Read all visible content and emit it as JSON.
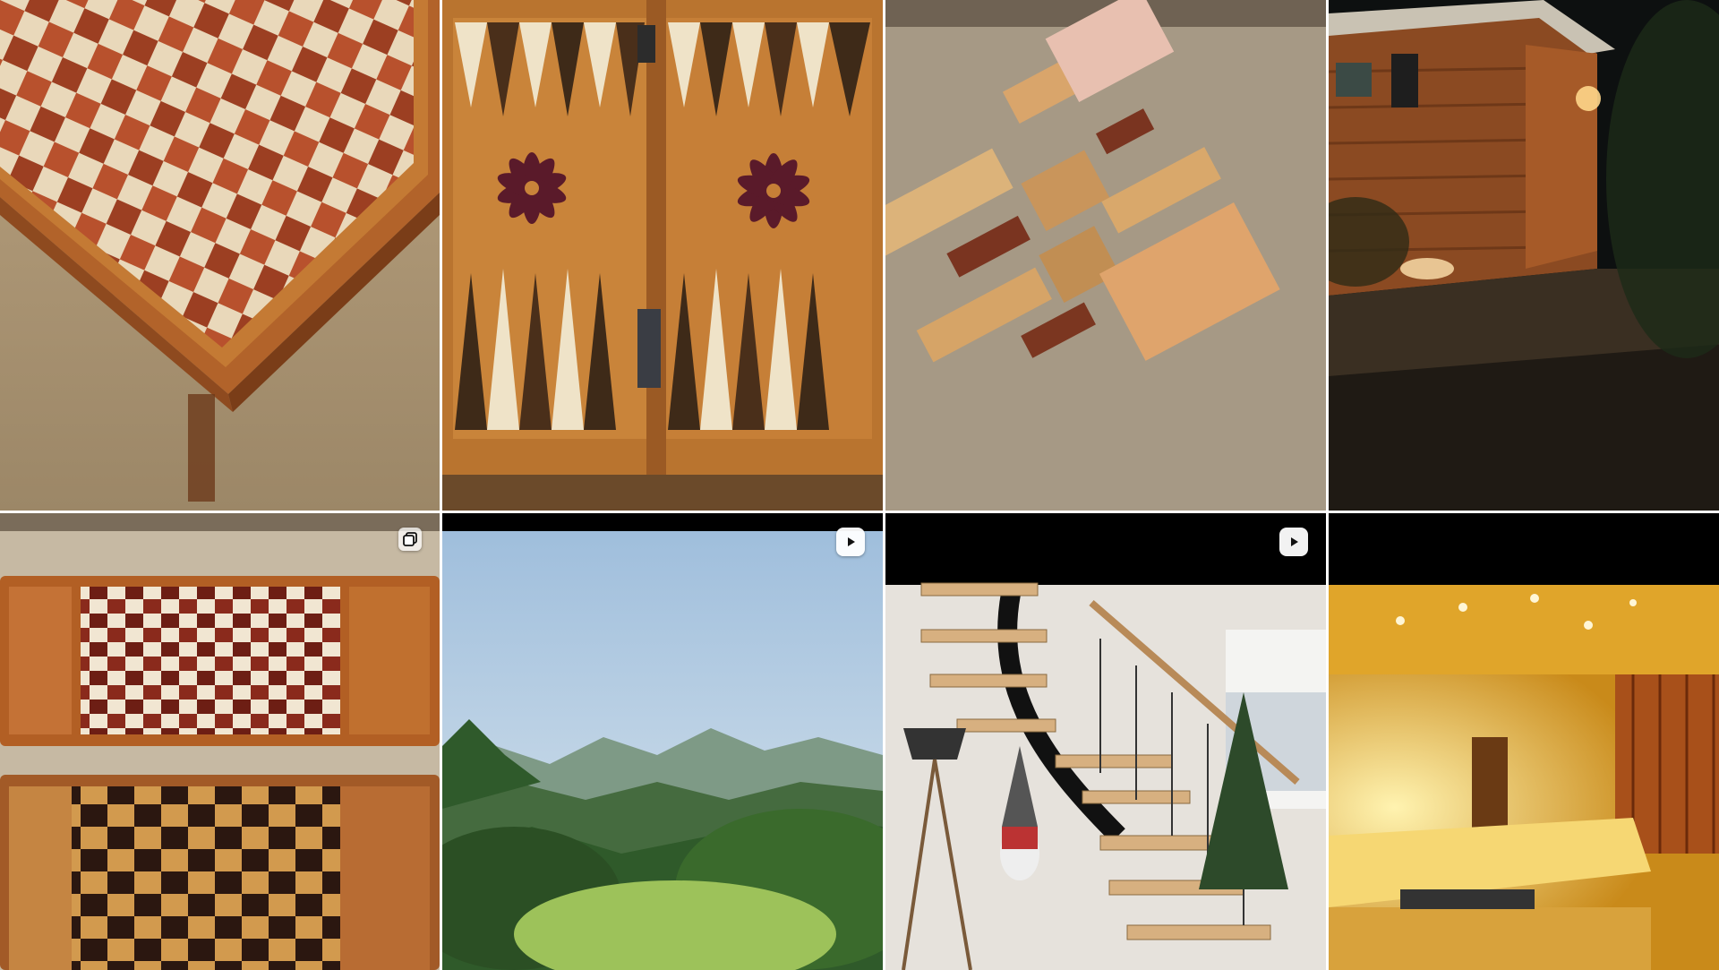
{
  "grid": {
    "posts": [
      {
        "id": "post-1",
        "media_type": "image",
        "subject": "chessboard-table"
      },
      {
        "id": "post-2",
        "media_type": "image",
        "subject": "backgammon-board"
      },
      {
        "id": "post-3",
        "media_type": "image",
        "subject": "woodworking-parts"
      },
      {
        "id": "post-4",
        "media_type": "image",
        "subject": "wooden-cabin-night"
      },
      {
        "id": "post-5",
        "media_type": "carousel",
        "subject": "chess-trays",
        "badge_icon": "carousel-icon"
      },
      {
        "id": "post-6",
        "media_type": "video",
        "subject": "forest-mountains",
        "badge_icon": "play-icon"
      },
      {
        "id": "post-7",
        "media_type": "video",
        "subject": "staircase-interior",
        "badge_icon": "play-icon"
      },
      {
        "id": "post-8",
        "media_type": "image",
        "subject": "warm-lit-room"
      }
    ]
  },
  "colors": {
    "background": "#ffffff",
    "badge": "#ffffff",
    "badge_icon": "#111111"
  }
}
